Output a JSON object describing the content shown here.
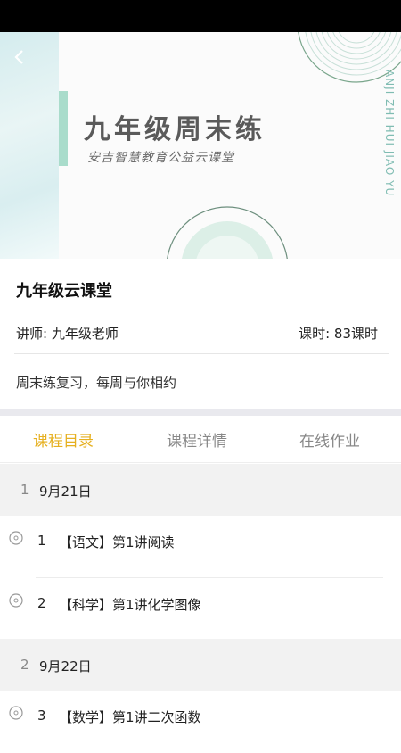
{
  "banner": {
    "title": "九年级周末练",
    "subtitle": "安吉智慧教育公益云课堂",
    "vertical_text": "ANJI ZHI HUI JIAO YU"
  },
  "course": {
    "name": "九年级云课堂",
    "teacher": "讲师: 九年级老师",
    "hours": "课时: 83课时",
    "description": "周末练复习，每周与你相约"
  },
  "tabs": [
    {
      "label": "课程目录",
      "active": true
    },
    {
      "label": "课程详情",
      "active": false
    },
    {
      "label": "在线作业",
      "active": false
    }
  ],
  "sections": [
    {
      "num": "1",
      "date": "9月21日",
      "items": [
        {
          "num": "1",
          "title": "【语文】第1讲阅读"
        },
        {
          "num": "2",
          "title": "【科学】第1讲化学图像"
        }
      ]
    },
    {
      "num": "2",
      "date": "9月22日",
      "items": [
        {
          "num": "3",
          "title": "【数学】第1讲二次函数"
        }
      ]
    }
  ],
  "colors": {
    "accent": "#e6b020",
    "banner_mint": "#a9dccb"
  }
}
